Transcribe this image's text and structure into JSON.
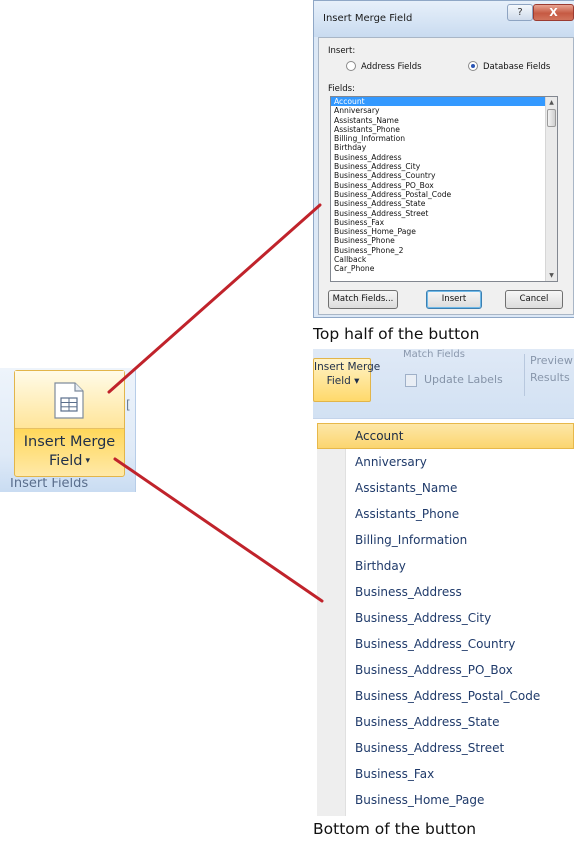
{
  "ribbon": {
    "button_label_line1": "Insert Merge",
    "button_label_line2": "Field",
    "dropdown_arrow": "▾",
    "group_label": "Insert Fields",
    "button_icon": "merge-field-document-icon"
  },
  "dialog": {
    "title": "Insert Merge Field",
    "help_button": "?",
    "close_button": "X",
    "insert_label": "Insert:",
    "radio_address": "Address Fields",
    "radio_database": "Database Fields",
    "selected_radio": "Database Fields",
    "fields_label": "Fields:",
    "fields": [
      "Account",
      "Anniversary",
      "Assistants_Name",
      "Assistants_Phone",
      "Billing_Information",
      "Birthday",
      "Business_Address",
      "Business_Address_City",
      "Business_Address_Country",
      "Business_Address_PO_Box",
      "Business_Address_Postal_Code",
      "Business_Address_State",
      "Business_Address_Street",
      "Business_Fax",
      "Business_Home_Page",
      "Business_Phone",
      "Business_Phone_2",
      "Callback",
      "Car_Phone"
    ],
    "selected_field": "Account",
    "match_fields_button": "Match Fields...",
    "insert_button": "Insert",
    "cancel_button": "Cancel"
  },
  "caption_top": "Top half of the button",
  "menu": {
    "mini_button_line1": "Insert Merge",
    "mini_button_line2": "Field ▾",
    "match_fields": "Match Fields",
    "update_labels": "Update Labels",
    "preview_line1": "Preview",
    "preview_line2": "Results",
    "items": [
      "Account",
      "Anniversary",
      "Assistants_Name",
      "Assistants_Phone",
      "Billing_Information",
      "Birthday",
      "Business_Address",
      "Business_Address_City",
      "Business_Address_Country",
      "Business_Address_PO_Box",
      "Business_Address_Postal_Code",
      "Business_Address_State",
      "Business_Address_Street",
      "Business_Fax",
      "Business_Home_Page"
    ],
    "selected_item": "Account"
  },
  "caption_bottom": "Bottom of the button",
  "colors": {
    "connector": "#c0232b",
    "ribbon_highlight": "#ffd75a",
    "list_selection": "#3399ff",
    "menu_selection": "#fbd56f",
    "menu_text": "#1f3a6a"
  }
}
